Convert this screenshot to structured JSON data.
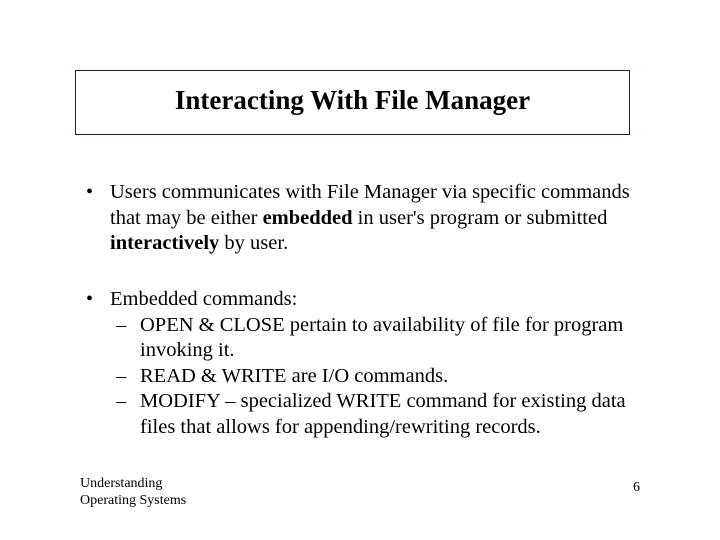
{
  "title": "Interacting With File Manager",
  "bullets": {
    "b1_pre": "Users communicates with File Manager via specific commands that may be either ",
    "b1_bold1": "embedded",
    "b1_mid": " in user's program or submitted ",
    "b1_bold2": "interactively",
    "b1_post": " by user.",
    "b2_head": "Embedded commands:",
    "s1": "OPEN & CLOSE pertain to availability of file for program invoking it.",
    "s2": "READ & WRITE are I/O commands.",
    "s3": "MODIFY – specialized WRITE command for existing data files that allows for appending/rewriting records."
  },
  "footer": {
    "left_line1": "Understanding",
    "left_line2": "Operating Systems",
    "page": "6"
  }
}
